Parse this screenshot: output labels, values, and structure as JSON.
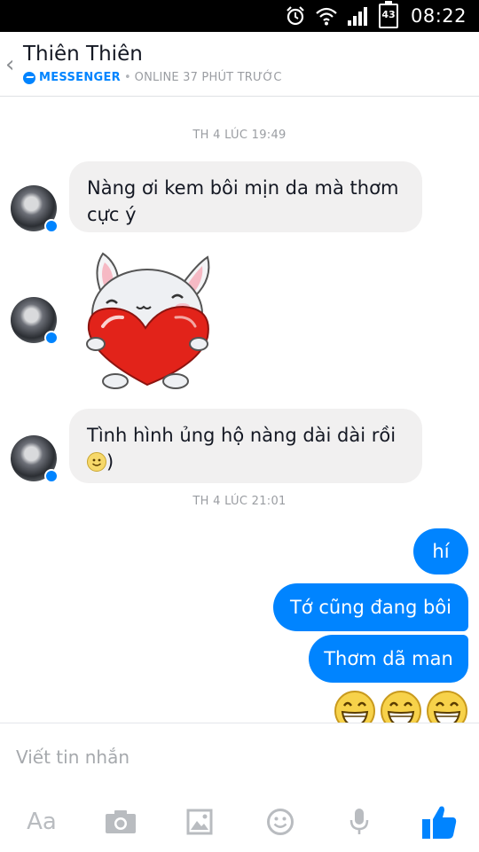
{
  "status_bar": {
    "time": "08:22",
    "battery": "43",
    "icons": [
      "alarm-icon",
      "wifi-icon",
      "signal-icon",
      "battery-icon"
    ]
  },
  "header": {
    "contact_name": "Thiên Thiên",
    "source": "MESSENGER",
    "separator": "•",
    "status": "ONLINE 37 PHÚT TRƯỚC"
  },
  "thread": {
    "timestamp_1": "TH 4 LÚC 19:49",
    "timestamp_2": "TH 4 LÚC 21:01",
    "incoming": [
      {
        "text": "Nàng ơi kem bôi mịn da mà thơm cực ý"
      },
      {
        "text_before_emoji": "Tình hình ủng hộ nàng dài dài rồi",
        "emoji": "slightly-smiling-emoji",
        "text_after_emoji": ")"
      }
    ],
    "sticker": "bunny-hugging-heart-sticker",
    "outgoing": [
      {
        "text": "hí"
      },
      {
        "text": "Tớ cũng đang bôi"
      },
      {
        "text": "Thơm dã man"
      }
    ],
    "emoji_row": [
      "grinning-emoji",
      "grinning-emoji",
      "grinning-emoji"
    ]
  },
  "composer": {
    "placeholder": "Viết tin nhắn",
    "toolbar": {
      "text_label": "Aa",
      "icons": [
        "camera-icon",
        "gallery-icon",
        "emoji-icon",
        "microphone-icon",
        "like-icon"
      ]
    }
  },
  "colors": {
    "accent": "#0084ff",
    "incoming_bubble": "#f1f0f0",
    "status_bar": "#000000",
    "icon_gray": "#b9bcc0"
  }
}
